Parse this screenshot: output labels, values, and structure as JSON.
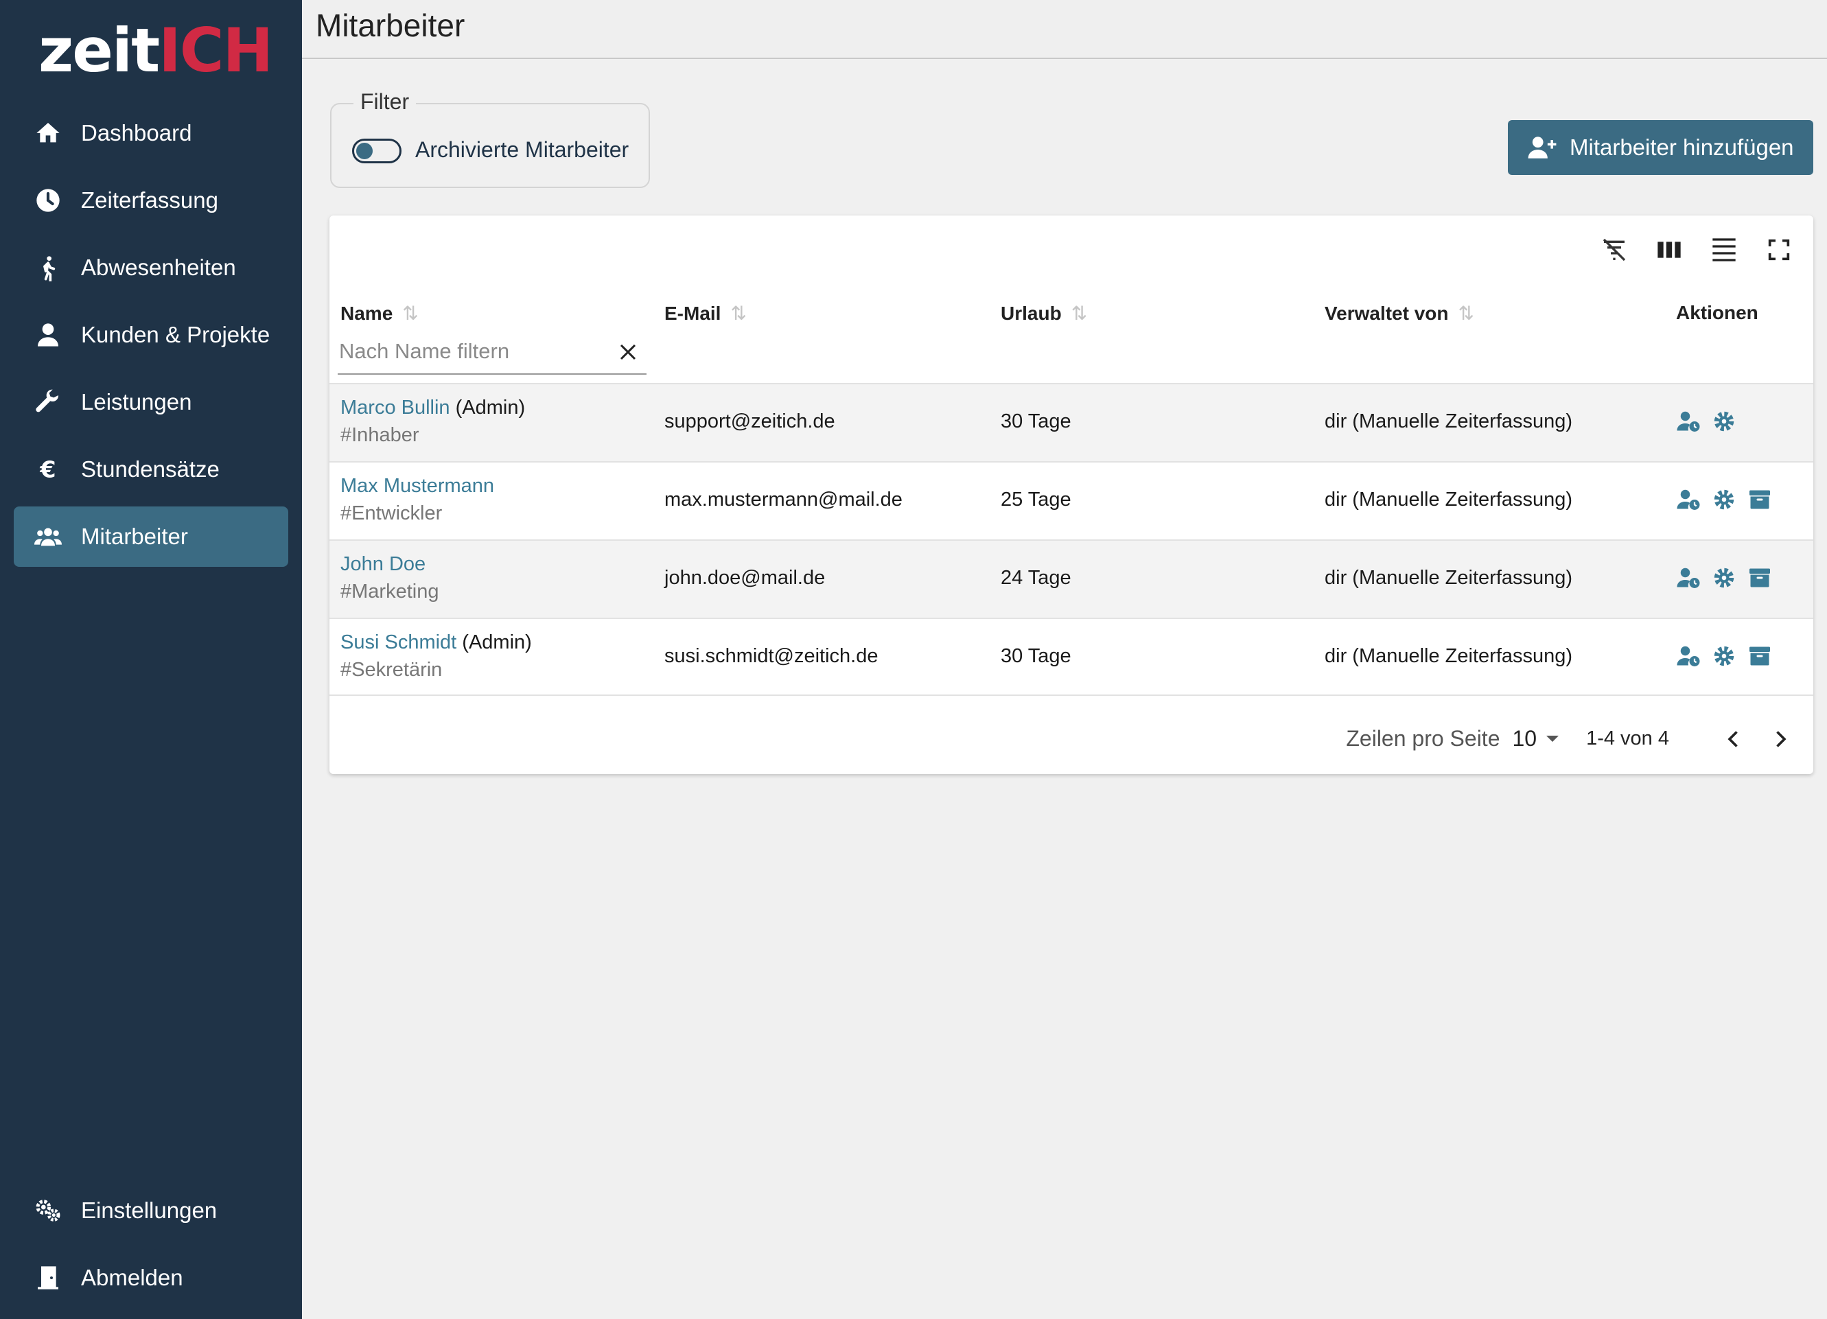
{
  "app": {
    "logo_part1": "zeit",
    "logo_part2": "ICH"
  },
  "colors": {
    "sidebar_bg": "#1f3347",
    "accent": "#3b6b83",
    "link": "#3b7c97",
    "logo_red": "#d12a44"
  },
  "sidebar": {
    "items": [
      {
        "label": "Dashboard",
        "icon": "home-icon"
      },
      {
        "label": "Zeiterfassung",
        "icon": "clock-icon"
      },
      {
        "label": "Abwesenheiten",
        "icon": "walking-icon"
      },
      {
        "label": "Kunden & Projekte",
        "icon": "user-icon"
      },
      {
        "label": "Leistungen",
        "icon": "wrench-icon"
      },
      {
        "label": "Stundensätze",
        "icon": "euro-icon"
      },
      {
        "label": "Mitarbeiter",
        "icon": "users-icon",
        "active": true
      }
    ],
    "bottom_items": [
      {
        "label": "Einstellungen",
        "icon": "gears-icon"
      },
      {
        "label": "Abmelden",
        "icon": "door-icon"
      }
    ]
  },
  "header": {
    "title": "Mitarbeiter"
  },
  "filter": {
    "legend": "Filter",
    "toggle_label": "Archivierte Mitarbeiter",
    "toggle_on": false
  },
  "add_button": {
    "label": "Mitarbeiter hinzufügen"
  },
  "table": {
    "toolbar_icons": [
      "filter-off-icon",
      "columns-icon",
      "density-icon",
      "fullscreen-icon"
    ],
    "columns": {
      "name": "Name",
      "email": "E-Mail",
      "urlaub": "Urlaub",
      "verwaltet": "Verwaltet von",
      "aktionen": "Aktionen"
    },
    "sort_glyph": "⇅",
    "name_filter_placeholder": "Nach Name filtern",
    "rows": [
      {
        "name": "Marco Bullin",
        "role": " (Admin)",
        "tag": "#Inhaber",
        "email": "support@zeitich.de",
        "urlaub": "30 Tage",
        "verwaltet": "dir (Manuelle Zeiterfassung)",
        "archive": false
      },
      {
        "name": "Max Mustermann",
        "role": "",
        "tag": "#Entwickler",
        "email": "max.mustermann@mail.de",
        "urlaub": "25 Tage",
        "verwaltet": "dir (Manuelle Zeiterfassung)",
        "archive": true
      },
      {
        "name": "John Doe",
        "role": "",
        "tag": "#Marketing",
        "email": "john.doe@mail.de",
        "urlaub": "24 Tage",
        "verwaltet": "dir (Manuelle Zeiterfassung)",
        "archive": true
      },
      {
        "name": "Susi Schmidt",
        "role": " (Admin)",
        "tag": "#Sekretärin",
        "email": "susi.schmidt@zeitich.de",
        "urlaub": "30 Tage",
        "verwaltet": "dir (Manuelle Zeiterfassung)",
        "archive": true
      }
    ]
  },
  "pagination": {
    "rows_per_page_label": "Zeilen pro Seite",
    "rows_per_page": "10",
    "range": "1-4 von 4"
  }
}
